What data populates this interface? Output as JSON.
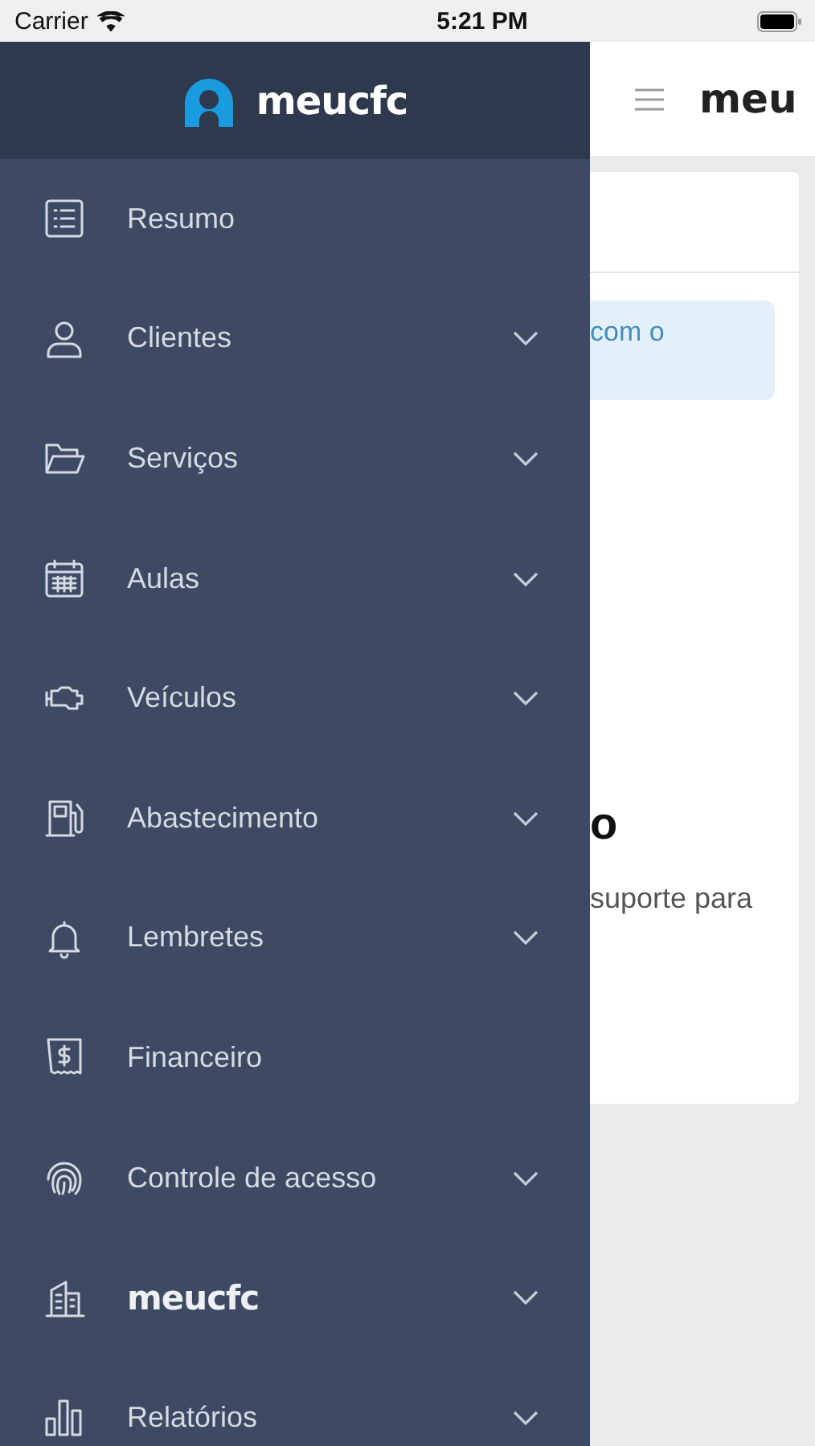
{
  "status_bar": {
    "carrier": "Carrier",
    "time": "5:21 PM"
  },
  "drawer": {
    "brand": "meucfc",
    "items": [
      {
        "label": "Resumo",
        "kind": "label",
        "expandable": false
      },
      {
        "label": "Clientes",
        "kind": "label",
        "expandable": true
      },
      {
        "label": "Serviços",
        "kind": "label",
        "expandable": true
      },
      {
        "label": "Aulas",
        "kind": "label",
        "expandable": true
      },
      {
        "label": "Veículos",
        "kind": "label",
        "expandable": true
      },
      {
        "label": "Abastecimento",
        "kind": "label",
        "expandable": true
      },
      {
        "label": "Lembretes",
        "kind": "label",
        "expandable": true
      },
      {
        "label": "Financeiro",
        "kind": "label",
        "expandable": false
      },
      {
        "label": "Controle de acesso",
        "kind": "label",
        "expandable": true
      },
      {
        "label": "meucfc",
        "kind": "brand",
        "expandable": true
      },
      {
        "label": "Relatórios",
        "kind": "label",
        "expandable": true
      }
    ]
  },
  "background_page": {
    "header_title": "meu",
    "notice": "com o",
    "heading": "o",
    "text": "suporte para"
  }
}
